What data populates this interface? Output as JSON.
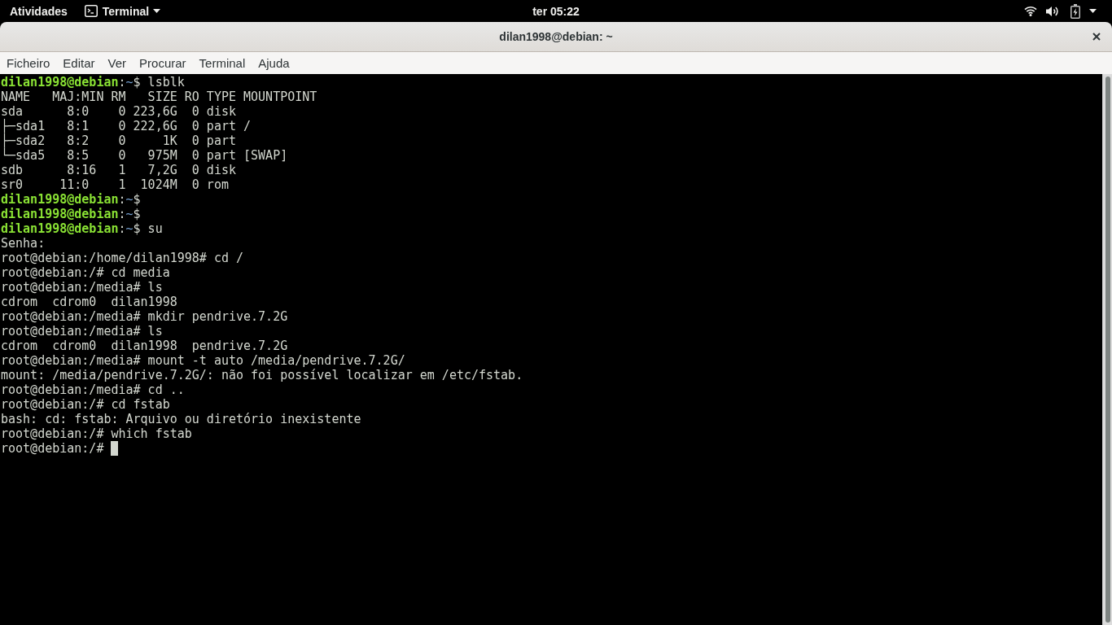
{
  "top_bar": {
    "activities": "Atividades",
    "app_menu": {
      "label": "Terminal"
    },
    "clock": "ter 05:22"
  },
  "window": {
    "title": "dilan1998@debian: ~"
  },
  "menu_bar": {
    "items": [
      "Ficheiro",
      "Editar",
      "Ver",
      "Procurar",
      "Terminal",
      "Ajuda"
    ]
  },
  "terminal": {
    "cursor": true,
    "lines": [
      {
        "segments": [
          {
            "kind": "user",
            "text": "dilan1998@debian"
          },
          {
            "kind": "plain",
            "text": ":"
          },
          {
            "kind": "path",
            "text": "~"
          },
          {
            "kind": "plain",
            "text": "$ lsblk"
          }
        ]
      },
      {
        "segments": [
          {
            "kind": "plain",
            "text": "NAME   MAJ:MIN RM   SIZE RO TYPE MOUNTPOINT"
          }
        ]
      },
      {
        "segments": [
          {
            "kind": "plain",
            "text": "sda      8:0    0 223,6G  0 disk"
          }
        ]
      },
      {
        "segments": [
          {
            "kind": "plain",
            "text": "├─sda1   8:1    0 222,6G  0 part /"
          }
        ]
      },
      {
        "segments": [
          {
            "kind": "plain",
            "text": "├─sda2   8:2    0     1K  0 part"
          }
        ]
      },
      {
        "segments": [
          {
            "kind": "plain",
            "text": "└─sda5   8:5    0   975M  0 part [SWAP]"
          }
        ]
      },
      {
        "segments": [
          {
            "kind": "plain",
            "text": "sdb      8:16   1   7,2G  0 disk"
          }
        ]
      },
      {
        "segments": [
          {
            "kind": "plain",
            "text": "sr0     11:0    1  1024M  0 rom"
          }
        ]
      },
      {
        "segments": [
          {
            "kind": "user",
            "text": "dilan1998@debian"
          },
          {
            "kind": "plain",
            "text": ":"
          },
          {
            "kind": "path",
            "text": "~"
          },
          {
            "kind": "plain",
            "text": "$"
          }
        ]
      },
      {
        "segments": [
          {
            "kind": "user",
            "text": "dilan1998@debian"
          },
          {
            "kind": "plain",
            "text": ":"
          },
          {
            "kind": "path",
            "text": "~"
          },
          {
            "kind": "plain",
            "text": "$"
          }
        ]
      },
      {
        "segments": [
          {
            "kind": "user",
            "text": "dilan1998@debian"
          },
          {
            "kind": "plain",
            "text": ":"
          },
          {
            "kind": "path",
            "text": "~"
          },
          {
            "kind": "plain",
            "text": "$ su"
          }
        ]
      },
      {
        "segments": [
          {
            "kind": "plain",
            "text": "Senha:"
          }
        ]
      },
      {
        "segments": [
          {
            "kind": "plain",
            "text": "root@debian:/home/dilan1998# cd /"
          }
        ]
      },
      {
        "segments": [
          {
            "kind": "plain",
            "text": "root@debian:/# cd media"
          }
        ]
      },
      {
        "segments": [
          {
            "kind": "plain",
            "text": "root@debian:/media# ls"
          }
        ]
      },
      {
        "segments": [
          {
            "kind": "plain",
            "text": "cdrom  cdrom0  dilan1998"
          }
        ]
      },
      {
        "segments": [
          {
            "kind": "plain",
            "text": "root@debian:/media# mkdir pendrive.7.2G"
          }
        ]
      },
      {
        "segments": [
          {
            "kind": "plain",
            "text": "root@debian:/media# ls"
          }
        ]
      },
      {
        "segments": [
          {
            "kind": "plain",
            "text": "cdrom  cdrom0  dilan1998  pendrive.7.2G"
          }
        ]
      },
      {
        "segments": [
          {
            "kind": "plain",
            "text": "root@debian:/media# mount -t auto /media/pendrive.7.2G/"
          }
        ]
      },
      {
        "segments": [
          {
            "kind": "plain",
            "text": "mount: /media/pendrive.7.2G/: não foi possível localizar em /etc/fstab."
          }
        ]
      },
      {
        "segments": [
          {
            "kind": "plain",
            "text": "root@debian:/media# cd .."
          }
        ]
      },
      {
        "segments": [
          {
            "kind": "plain",
            "text": "root@debian:/# cd fstab"
          }
        ]
      },
      {
        "segments": [
          {
            "kind": "plain",
            "text": "bash: cd: fstab: Arquivo ou diretório inexistente"
          }
        ]
      },
      {
        "segments": [
          {
            "kind": "plain",
            "text": "root@debian:/# which fstab"
          }
        ]
      },
      {
        "segments": [
          {
            "kind": "plain",
            "text": "root@debian:/# "
          }
        ]
      }
    ]
  }
}
